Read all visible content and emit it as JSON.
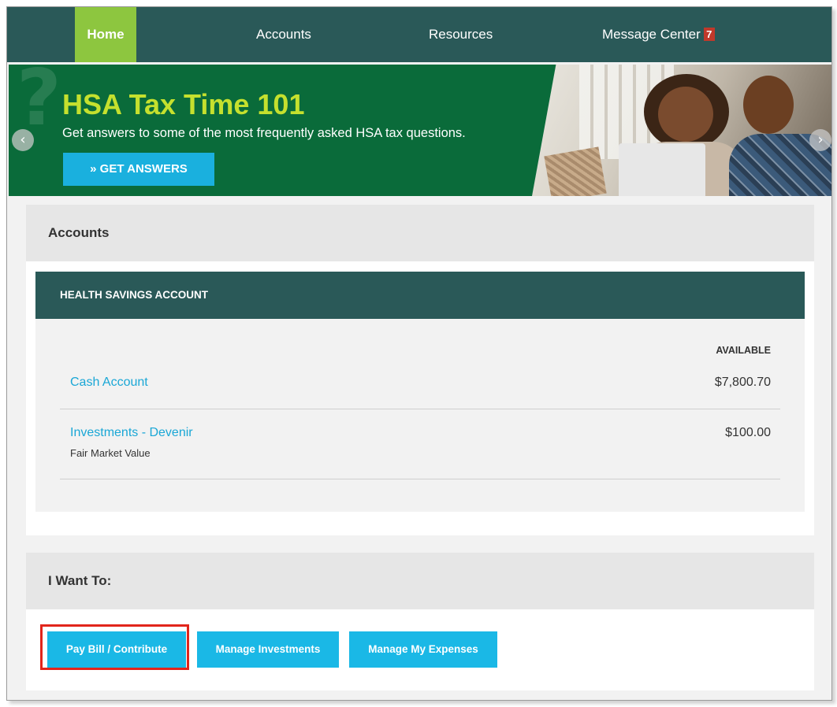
{
  "nav": {
    "items": [
      {
        "label": "Home"
      },
      {
        "label": "Accounts"
      },
      {
        "label": "Resources"
      },
      {
        "label": "Message Center"
      }
    ],
    "message_count": "7"
  },
  "banner": {
    "title": "HSA Tax Time 101",
    "subtitle": "Get answers to some of the most frequently asked HSA tax questions.",
    "button_label": "» GET ANSWERS",
    "prev_arrow": "‹",
    "next_arrow": "›"
  },
  "accounts": {
    "heading": "Accounts",
    "card_title": "HEALTH SAVINGS ACCOUNT",
    "column_label": "AVAILABLE",
    "rows": [
      {
        "name": "Cash Account",
        "sub": "",
        "value": "$7,800.70"
      },
      {
        "name": "Investments - Devenir",
        "sub": "Fair Market Value",
        "value": "$100.00"
      }
    ]
  },
  "want_to": {
    "heading": "I Want To:",
    "buttons": [
      {
        "label": "Pay Bill / Contribute"
      },
      {
        "label": "Manage Investments"
      },
      {
        "label": "Manage My Expenses"
      }
    ]
  },
  "colors": {
    "nav_bg": "#2a5958",
    "home_active": "#8dc63f",
    "banner_bg": "#0a6b3a",
    "banner_title": "#c5e02e",
    "accent_button": "#1ab8e6",
    "link": "#1aa7d6",
    "highlight_border": "#e1251b"
  }
}
